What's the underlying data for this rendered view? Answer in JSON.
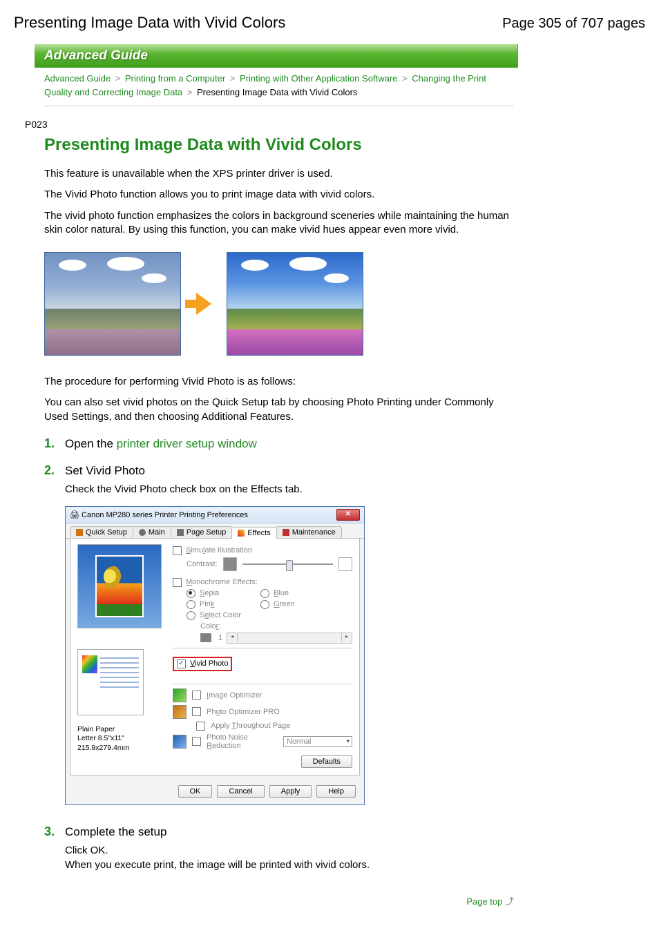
{
  "header": {
    "title": "Presenting Image Data with Vivid Colors",
    "page_indicator": "Page 305 of 707 pages"
  },
  "banner": "Advanced Guide",
  "breadcrumb": {
    "l1": "Advanced Guide",
    "l2": "Printing from a Computer",
    "l3": "Printing with Other Application Software",
    "l4": "Changing the Print Quality and Correcting Image Data",
    "current": "Presenting Image Data with Vivid Colors",
    "sep": ">"
  },
  "doc_code": "P023",
  "title": "Presenting Image Data with Vivid Colors",
  "paragraphs": {
    "p1": "This feature is unavailable when the XPS printer driver is used.",
    "p2": "The Vivid Photo function allows you to print image data with vivid colors.",
    "p3": "The vivid photo function emphasizes the colors in background sceneries while maintaining the human skin color natural. By using this function, you can make vivid hues appear even more vivid.",
    "p4": "The procedure for performing Vivid Photo is as follows:",
    "p5": "You can also set vivid photos on the Quick Setup tab by choosing Photo Printing under Commonly Used Settings, and then choosing Additional Features."
  },
  "steps": {
    "s1": {
      "num": "1.",
      "title": "Open the ",
      "link": "printer driver setup window"
    },
    "s2": {
      "num": "2.",
      "title": "Set Vivid Photo",
      "body": "Check the Vivid Photo check box on the Effects tab."
    },
    "s3": {
      "num": "3.",
      "title": "Complete the setup",
      "body1": "Click OK.",
      "body2": "When you execute print, the image will be printed with vivid colors."
    }
  },
  "dialog": {
    "title": "Canon MP280 series Printer Printing Preferences",
    "tabs": {
      "quick": "Quick Setup",
      "main": "Main",
      "page": "Page Setup",
      "effects": "Effects",
      "maint": "Maintenance"
    },
    "simulate": "Simulate Illustration",
    "contrast": "Contrast:",
    "mono": "Monochrome Effects:",
    "radios": {
      "sepia": "Sepia",
      "blue": "Blue",
      "pink": "Pink",
      "green": "Green",
      "select": "Select Color"
    },
    "color": "Color:",
    "vivid": "Vivid Photo",
    "img_opt": "Image Optimizer",
    "pro": "Photo Optimizer PRO",
    "apply_thru": "Apply Throughout Page",
    "noise": "Photo Noise Reduction",
    "noise_val": "Normal",
    "media1": "Plain Paper",
    "media2": "Letter 8.5\"x11\" 215.9x279.4mm",
    "defaults": "Defaults",
    "ok": "OK",
    "cancel": "Cancel",
    "apply": "Apply",
    "help": "Help",
    "one": "1"
  },
  "page_top": "Page top"
}
